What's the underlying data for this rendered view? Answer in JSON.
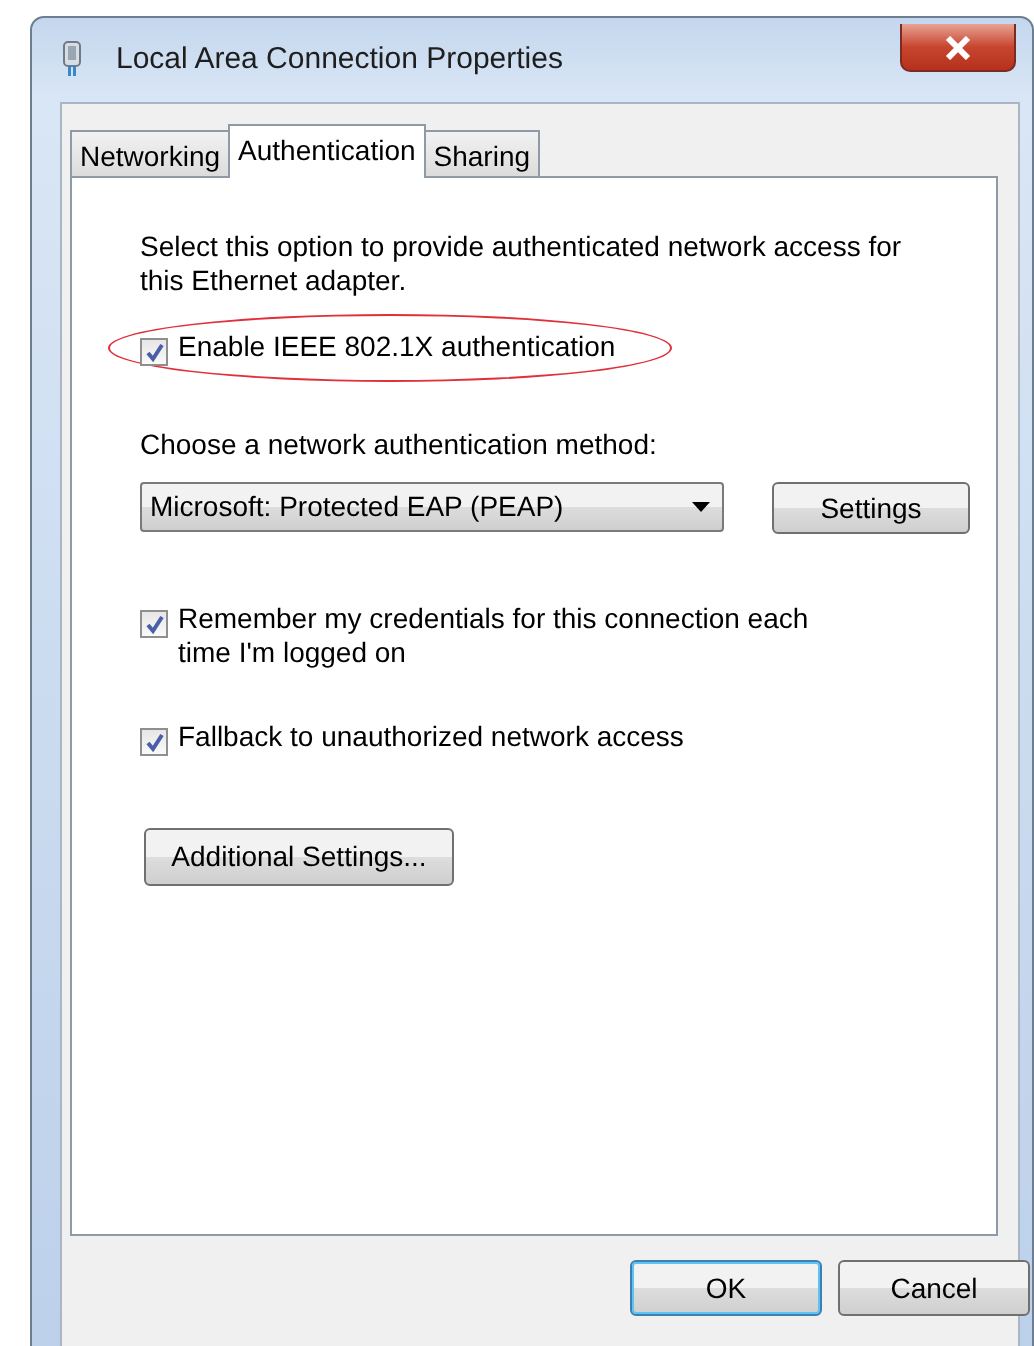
{
  "window": {
    "title": "Local Area Connection Properties"
  },
  "tabs": [
    {
      "label": "Networking",
      "selected": false
    },
    {
      "label": "Authentication",
      "selected": true
    },
    {
      "label": "Sharing",
      "selected": false
    }
  ],
  "authentication": {
    "description": "Select this option to provide authenticated network access for this Ethernet adapter.",
    "enable_option": {
      "label": "Enable IEEE 802.1X authentication",
      "checked": true,
      "highlighted": true
    },
    "method_label": "Choose a network authentication method:",
    "method_dropdown": {
      "value": "Microsoft: Protected EAP (PEAP)"
    },
    "settings_button": "Settings",
    "options": [
      {
        "label": "Remember my credentials for this connection each time I'm logged on",
        "checked": true
      },
      {
        "label": "Fallback to unauthorized network access",
        "checked": true
      }
    ],
    "additional_button": "Additional Settings..."
  },
  "buttons": [
    {
      "label": "OK",
      "default": true
    },
    {
      "label": "Cancel",
      "default": false
    }
  ]
}
